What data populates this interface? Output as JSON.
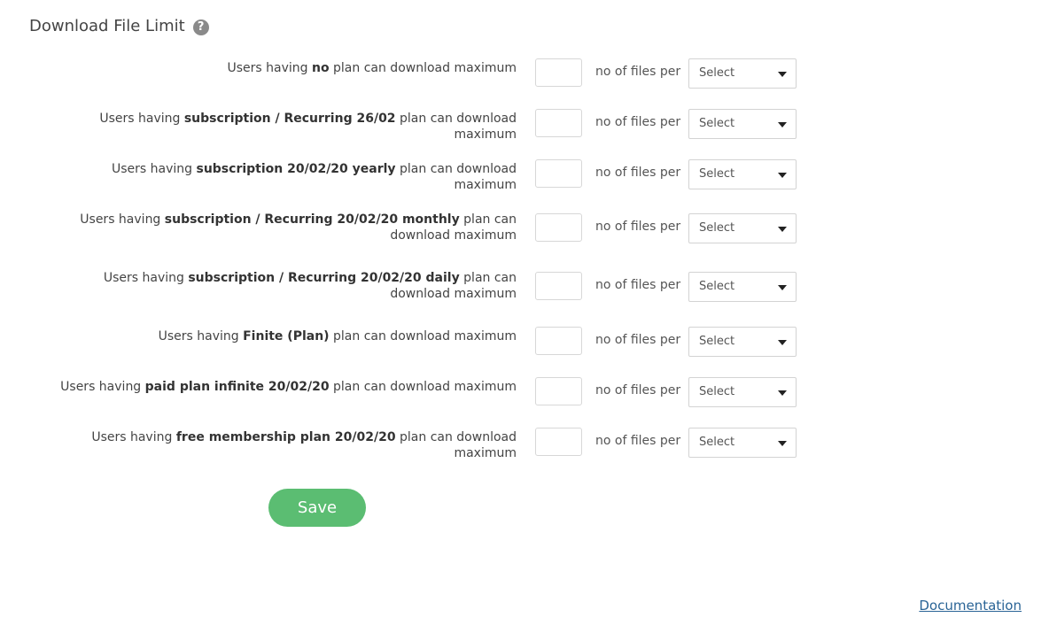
{
  "header": {
    "title": "Download File Limit",
    "help_icon": "?"
  },
  "per_label": "no of files per",
  "select_placeholder": "Select",
  "rows": [
    {
      "prefix": "Users having ",
      "plan": "no",
      "suffix": " plan can download maximum"
    },
    {
      "prefix": "Users having ",
      "plan": "subscription / Recurring 26/02",
      "suffix": " plan can download maximum"
    },
    {
      "prefix": "Users having ",
      "plan": "subscription 20/02/20 yearly",
      "suffix": " plan can download maximum"
    },
    {
      "prefix": "Users having ",
      "plan": "subscription / Recurring 20/02/20 monthly",
      "suffix": " plan can download maximum"
    },
    {
      "prefix": "Users having ",
      "plan": "subscription / Recurring 20/02/20 daily",
      "suffix": " plan can download maximum"
    },
    {
      "prefix": "Users having ",
      "plan": "Finite (Plan)",
      "suffix": " plan can download maximum"
    },
    {
      "prefix": "Users having ",
      "plan": "paid plan infinite 20/02/20",
      "suffix": " plan can download maximum"
    },
    {
      "prefix": "Users having ",
      "plan": "free membership plan 20/02/20",
      "suffix": " plan can download maximum"
    }
  ],
  "save_label": "Save",
  "documentation_link": "Documentation",
  "colors": {
    "save_button": "#5bbd72",
    "link": "#2a6496",
    "help_icon": "#8a8a8a"
  }
}
